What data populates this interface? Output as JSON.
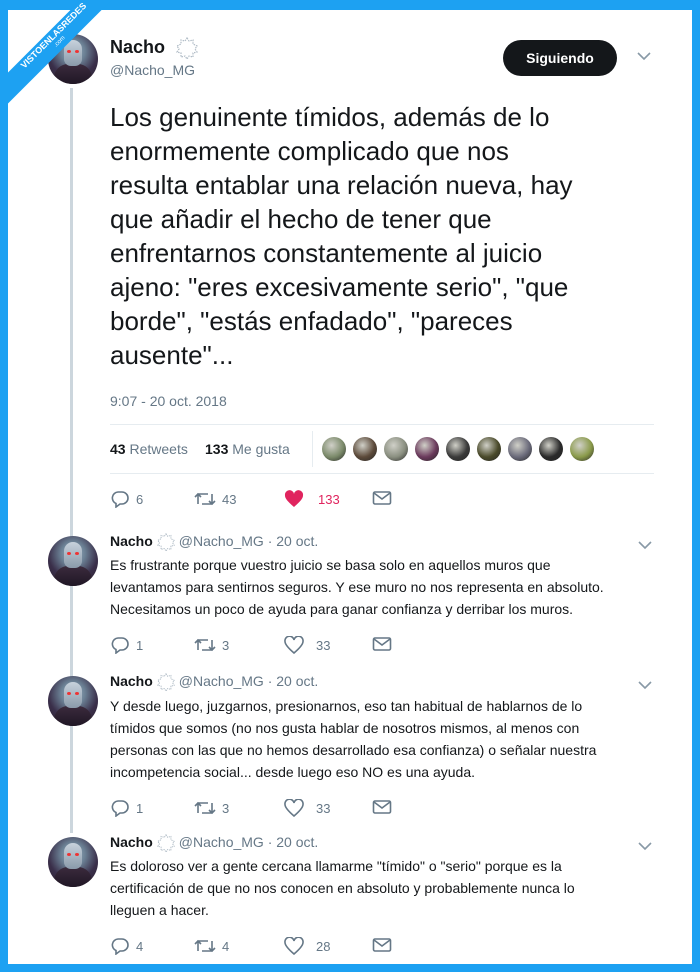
{
  "watermark": {
    "line1": "VISTOENLASREDES",
    "line2": ".com"
  },
  "main_tweet": {
    "author_name": "Nacho",
    "handle": "@Nacho_MG",
    "follow_label": "Siguiendo",
    "text": "Los genuinente tímidos, además de lo\nenormemente complicado que nos\nresulta entablar una relación nueva, hay\nque añadir el hecho de tener que\nenfrentarnos constantemente al juicio\najeno: \"eres excesivamente serio\", \"que\nborde\", \"estás enfadado\", \"pareces\nausente\"...",
    "timestamp": "9:07 - 20 oct. 2018",
    "retweets_count": "43",
    "retweets_label": "Retweets",
    "likes_count": "133",
    "likes_label": "Me gusta",
    "actions": {
      "replies": "6",
      "retweets": "43",
      "likes": "133"
    }
  },
  "replies": [
    {
      "author_name": "Nacho",
      "handle": "@Nacho_MG",
      "date": "· 20 oct.",
      "text": "Es frustrante porque vuestro juicio se basa solo en aquellos muros que\nlevantamos para sentirnos seguros. Y ese muro no nos representa en absoluto.\nNecesitamos un poco de ayuda para ganar confianza y derribar los muros.",
      "replies": "1",
      "retweets": "3",
      "likes": "33"
    },
    {
      "author_name": "Nacho",
      "handle": "@Nacho_MG",
      "date": "· 20 oct.",
      "text": "Y desde luego, juzgarnos, presionarnos, eso tan habitual de hablarnos de lo\ntímidos que somos (no nos gusta hablar de nosotros mismos, al menos con\npersonas con las que no hemos desarrollado esa confianza) o señalar nuestra\nincompetencia social... desde luego eso NO es una ayuda.",
      "replies": "1",
      "retweets": "3",
      "likes": "33"
    },
    {
      "author_name": "Nacho",
      "handle": "@Nacho_MG",
      "date": "· 20 oct.",
      "text": "Es doloroso ver a gente cercana llamarme \"tímido\" o \"serio\" porque es la\ncertificación de que no nos conocen en absoluto y probablemente nunca lo\nlleguen a hacer.",
      "replies": "4",
      "retweets": "4",
      "likes": "28"
    }
  ],
  "colors": {
    "frame": "#1da1f2",
    "text": "#14171a",
    "muted": "#657786",
    "like_active": "#e0245e",
    "follow_button": "#14171a"
  },
  "likers": [
    "#7b8a6a",
    "#5c4a3a",
    "#8a8f80",
    "#6b3a5c",
    "#3a3a3a",
    "#4a4a2a",
    "#6a6a7a",
    "#2a2a2a",
    "#8a9a4a"
  ]
}
